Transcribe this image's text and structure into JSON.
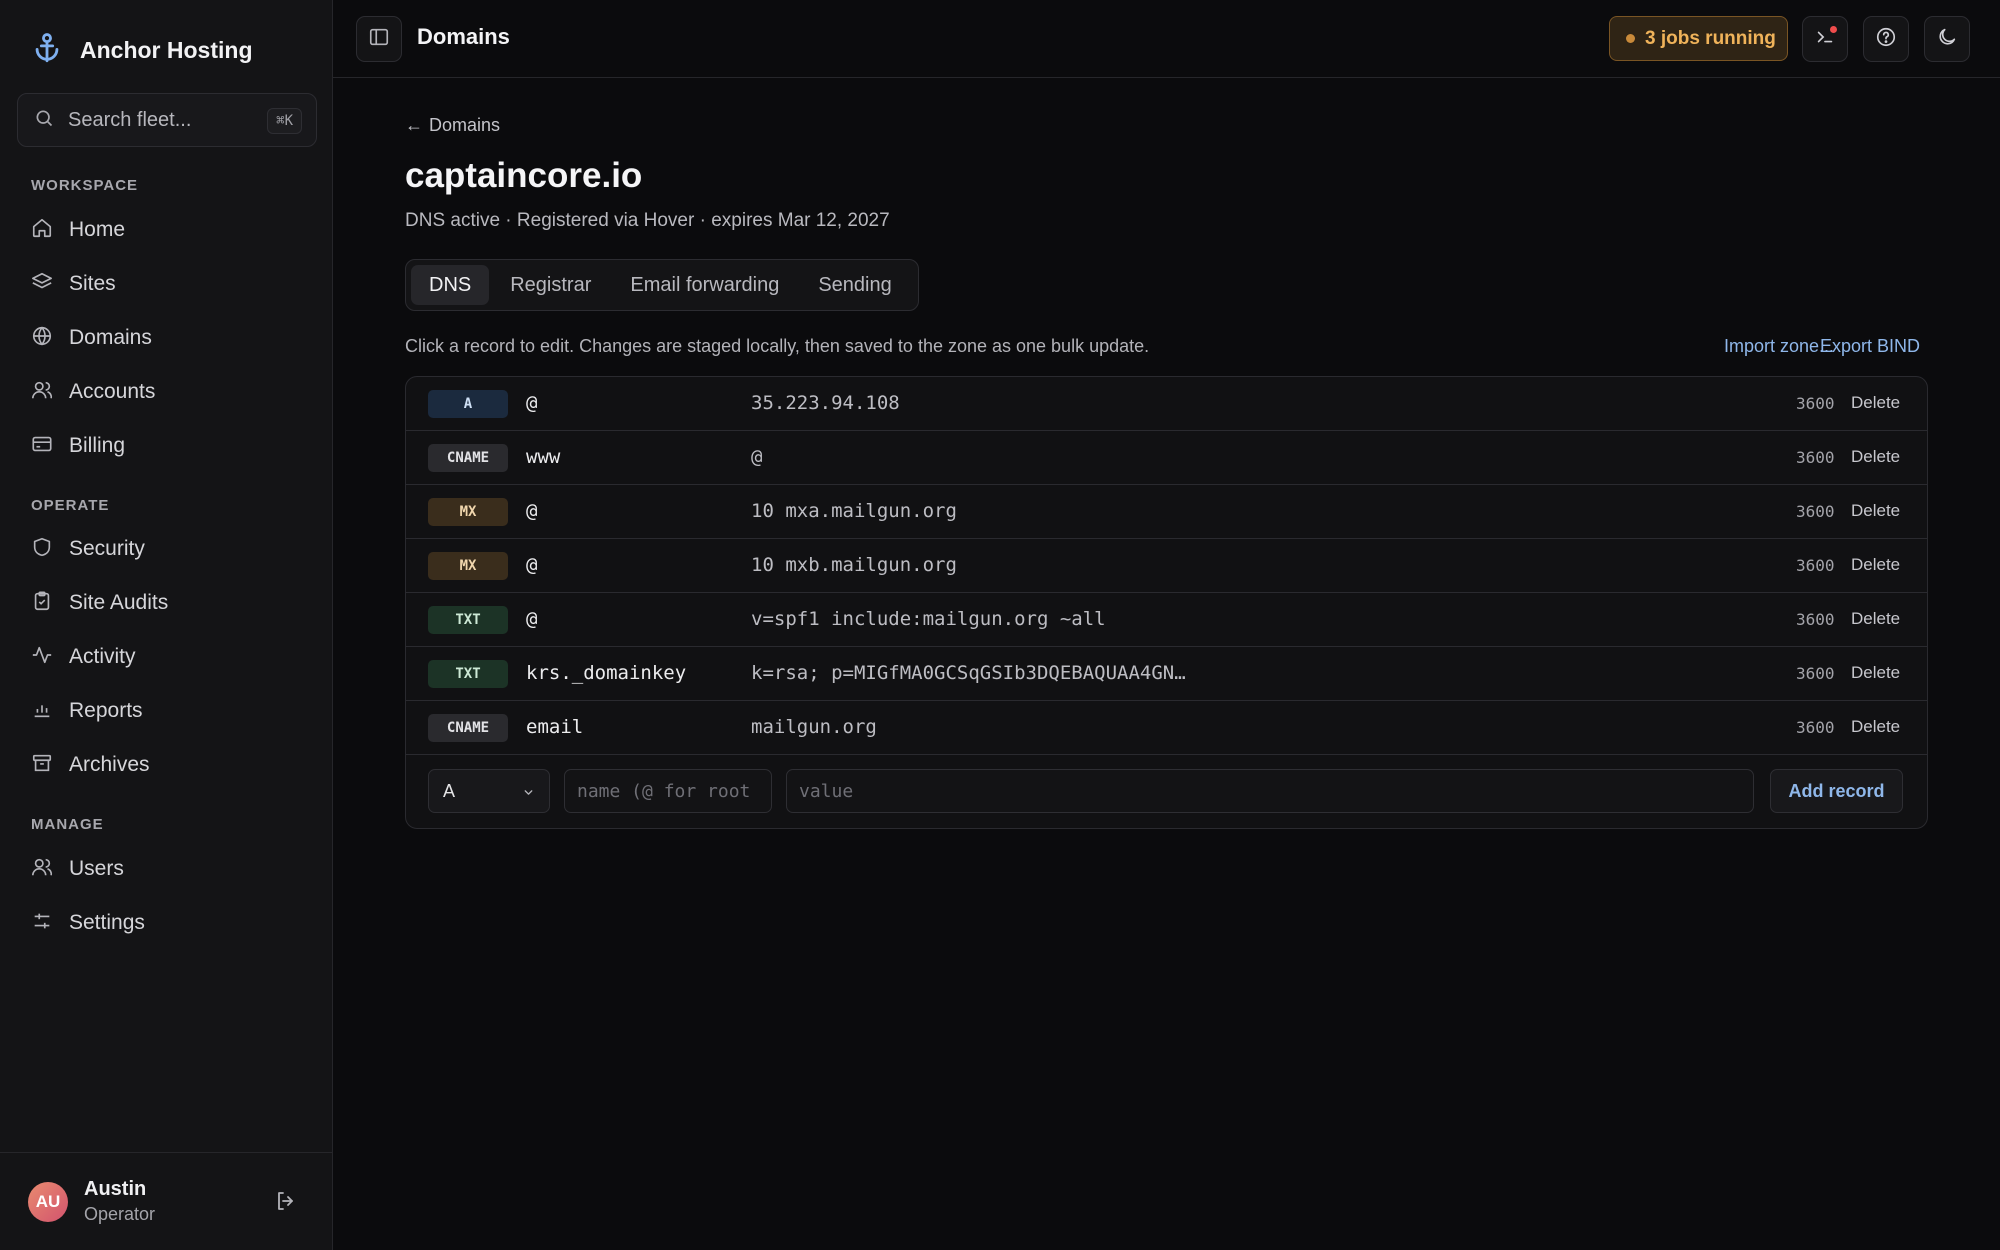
{
  "app": {
    "brand": "Anchor Hosting"
  },
  "search": {
    "placeholder": "Search fleet...",
    "shortcut": "⌘K"
  },
  "sidebar": {
    "sections": [
      {
        "title": "WORKSPACE",
        "items": [
          {
            "label": "Home",
            "icon": "home-icon"
          },
          {
            "label": "Sites",
            "icon": "layers-icon"
          },
          {
            "label": "Domains",
            "icon": "globe-icon"
          },
          {
            "label": "Accounts",
            "icon": "users-icon"
          },
          {
            "label": "Billing",
            "icon": "credit-card-icon"
          }
        ]
      },
      {
        "title": "OPERATE",
        "items": [
          {
            "label": "Security",
            "icon": "shield-icon"
          },
          {
            "label": "Site Audits",
            "icon": "clipboard-icon"
          },
          {
            "label": "Activity",
            "icon": "activity-icon"
          },
          {
            "label": "Reports",
            "icon": "bar-chart-icon"
          },
          {
            "label": "Archives",
            "icon": "archive-icon"
          }
        ]
      },
      {
        "title": "MANAGE",
        "items": [
          {
            "label": "Users",
            "icon": "users-icon"
          },
          {
            "label": "Settings",
            "icon": "sliders-icon"
          }
        ]
      }
    ]
  },
  "user": {
    "initials": "AU",
    "name": "Austin",
    "role": "Operator"
  },
  "topbar": {
    "title": "Domains",
    "jobs": "3 jobs running"
  },
  "page": {
    "back_label": "Domains",
    "domain": "captaincore.io",
    "subtitle": "DNS active · Registered via Hover · expires Mar 12, 2027",
    "tabs": [
      "DNS",
      "Registrar",
      "Email forwarding",
      "Sending"
    ],
    "active_tab": "DNS",
    "hint": "Click a record to edit. Changes are staged locally, then saved to the zone as one bulk update.",
    "import_label": "Import zone...",
    "export_label": "Export BIND"
  },
  "records": [
    {
      "type": "A",
      "name": "@",
      "value": "35.223.94.108",
      "ttl": "3600",
      "delete": "Delete"
    },
    {
      "type": "CNAME",
      "name": "www",
      "value": "@",
      "ttl": "3600",
      "delete": "Delete"
    },
    {
      "type": "MX",
      "name": "@",
      "value": "10 mxa.mailgun.org",
      "ttl": "3600",
      "delete": "Delete"
    },
    {
      "type": "MX",
      "name": "@",
      "value": "10 mxb.mailgun.org",
      "ttl": "3600",
      "delete": "Delete"
    },
    {
      "type": "TXT",
      "name": "@",
      "value": "v=spf1 include:mailgun.org ~all",
      "ttl": "3600",
      "delete": "Delete"
    },
    {
      "type": "TXT",
      "name": "krs._domainkey",
      "value": "k=rsa; p=MIGfMA0GCSqGSIb3DQEBAQUAA4GN…",
      "ttl": "3600",
      "delete": "Delete"
    },
    {
      "type": "CNAME",
      "name": "email",
      "value": "mailgun.org",
      "ttl": "3600",
      "delete": "Delete"
    }
  ],
  "badge_colors": {
    "A": {
      "bg": "#1b2a3e",
      "fg": "#cfe0f5"
    },
    "CNAME": {
      "bg": "#2a2a2e",
      "fg": "#e2e2e6"
    },
    "MX": {
      "bg": "#3a2d1c",
      "fg": "#f0d6ad"
    },
    "TXT": {
      "bg": "#1c3326",
      "fg": "#cde9d6"
    }
  },
  "add_record": {
    "type": "A",
    "name_placeholder": "name (@ for root",
    "value_placeholder": "value",
    "button": "Add record"
  },
  "colors": {
    "accent": "#8fb7ea",
    "jobs": "#f0b35a"
  }
}
